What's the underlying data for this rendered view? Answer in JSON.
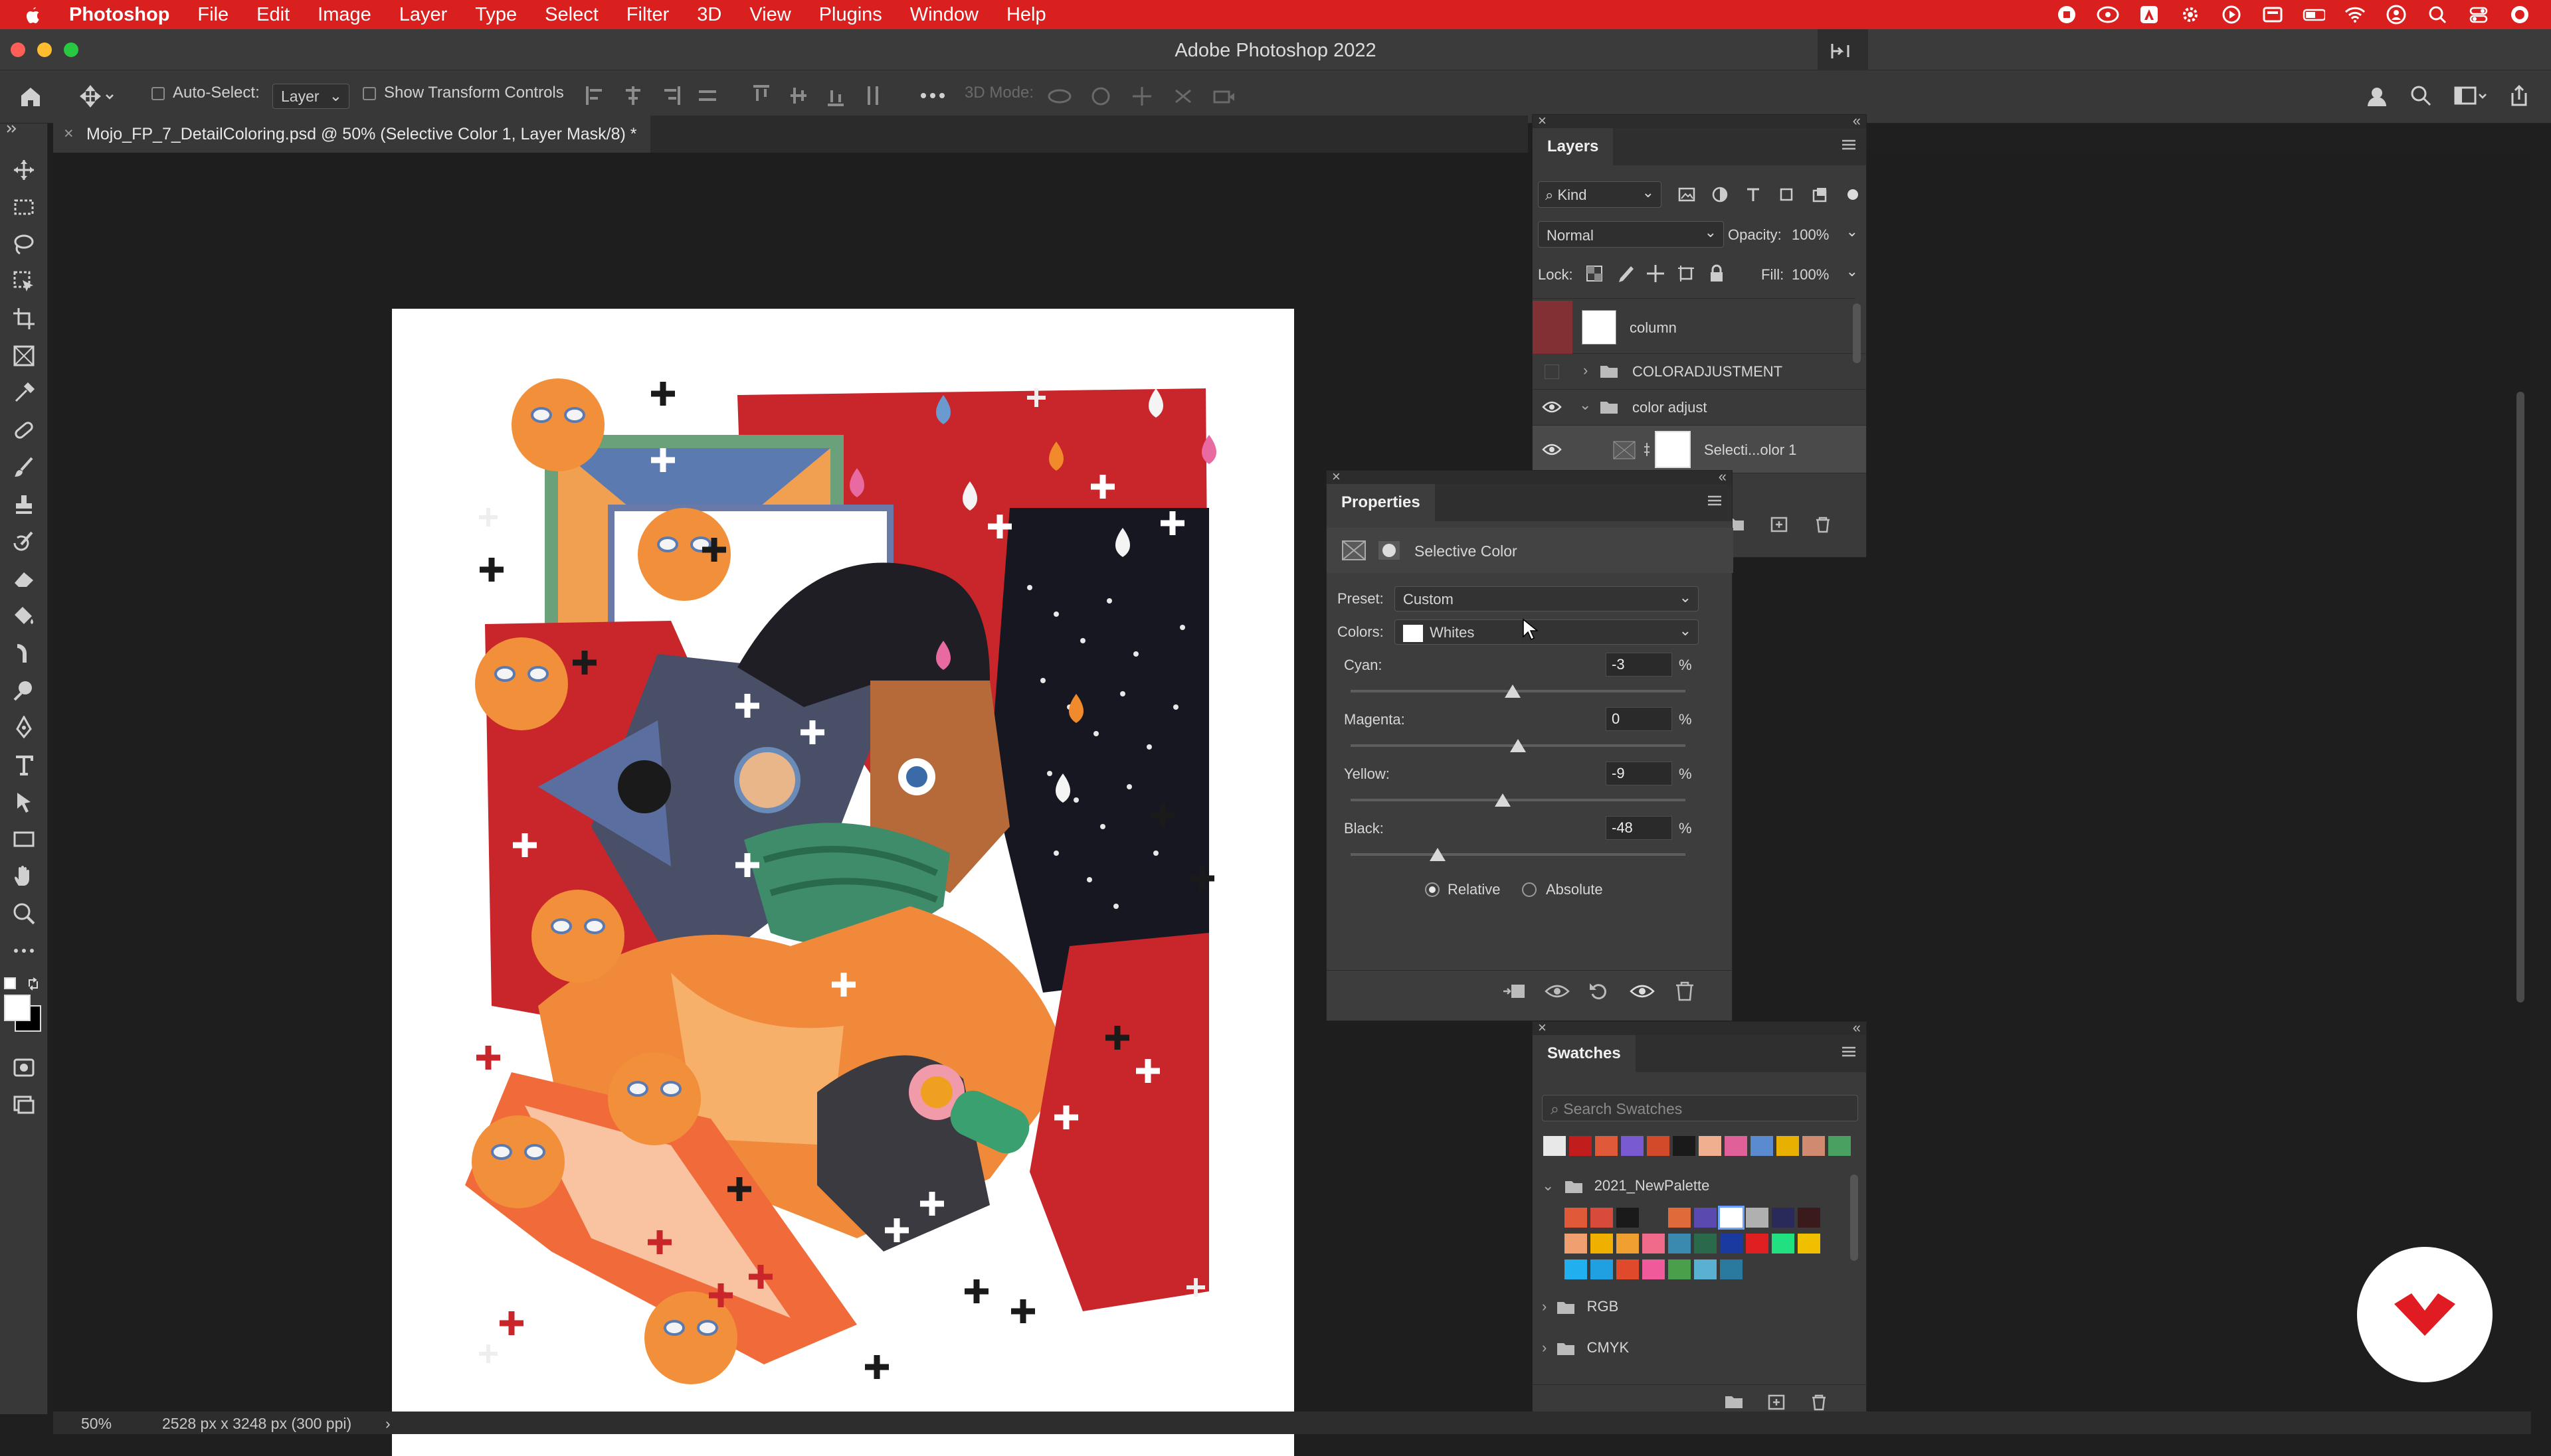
{
  "menubar": {
    "app_name": "Photoshop",
    "items": [
      "File",
      "Edit",
      "Image",
      "Layer",
      "Type",
      "Select",
      "Filter",
      "3D",
      "View",
      "Plugins",
      "Window",
      "Help"
    ]
  },
  "window": {
    "title": "Adobe Photoshop 2022"
  },
  "options": {
    "auto_select_label": "Auto-Select:",
    "auto_select_value": "Layer",
    "transform_label": "Show Transform Controls",
    "mode_3d_label": "3D Mode:"
  },
  "document": {
    "tab_title": "Mojo_FP_7_DetailColoring.psd @ 50% (Selective Color 1, Layer Mask/8) *"
  },
  "status": {
    "zoom": "50%",
    "dimensions": "2528 px x 3248 px (300 ppi)",
    "arrow": "›"
  },
  "layers_panel": {
    "title": "Layers",
    "filter_kind": "Kind",
    "blend_mode": "Normal",
    "opacity_label": "Opacity:",
    "opacity_value": "100%",
    "lock_label": "Lock:",
    "fill_label": "Fill:",
    "fill_value": "100%",
    "layers": [
      {
        "name": "column",
        "visible": false
      },
      {
        "name": "COLORADJUSTMENT",
        "visible": false
      },
      {
        "name": "color adjust",
        "visible": true
      },
      {
        "name": "Selecti...olor 1",
        "visible": true
      }
    ]
  },
  "properties_panel": {
    "title": "Properties",
    "adjustment_name": "Selective Color",
    "preset_label": "Preset:",
    "preset_value": "Custom",
    "colors_label": "Colors:",
    "colors_value": "Whites",
    "percent_sign": "%",
    "sliders": [
      {
        "label": "Cyan:",
        "value": -3
      },
      {
        "label": "Magenta:",
        "value": 0
      },
      {
        "label": "Yellow:",
        "value": -9
      },
      {
        "label": "Black:",
        "value": -48
      }
    ],
    "method_relative": "Relative",
    "method_absolute": "Absolute",
    "method_selected": "Relative"
  },
  "swatches_panel": {
    "title": "Swatches",
    "search_placeholder": "Search Swatches",
    "recent_colors": [
      "#e8e8e8",
      "#c21d1d",
      "#e05a3a",
      "#7a5ad0",
      "#d24a2a",
      "#1a1a1a",
      "#f0b090",
      "#e0609a",
      "#5a8ad0",
      "#e8b000",
      "#d08a70",
      "#4aa060"
    ],
    "groups": [
      {
        "name": "2021_NewPalette",
        "expanded": true
      },
      {
        "name": "RGB",
        "expanded": false
      },
      {
        "name": "CMYK",
        "expanded": false
      }
    ],
    "palette_colors": [
      "#e05a3a",
      "#d84a3a",
      "#1a1a1a",
      "#3a3a3a",
      "#e06a3a",
      "#5a4ab0",
      "#ffffff",
      "#b0b0b0",
      "#2a2a5a",
      "#3a1a1a",
      "#f0a070",
      "#f0b000",
      "#f0a030",
      "#f06a8a",
      "#3a8ab0",
      "#2a6a4a",
      "#1a3aa0",
      "#e02020",
      "#20e080",
      "#f0c000",
      "#20b0f0",
      "#20a0e0",
      "#e04a2a",
      "#f05a9a",
      "#4aa04a",
      "#5ab0d0",
      "#2a7aa0"
    ]
  },
  "colors": {
    "menubar": "#da1f1f",
    "panel_bg": "#3a3a3a",
    "canvas_bg": "#1e1e1e",
    "badge": "#e11b22"
  }
}
